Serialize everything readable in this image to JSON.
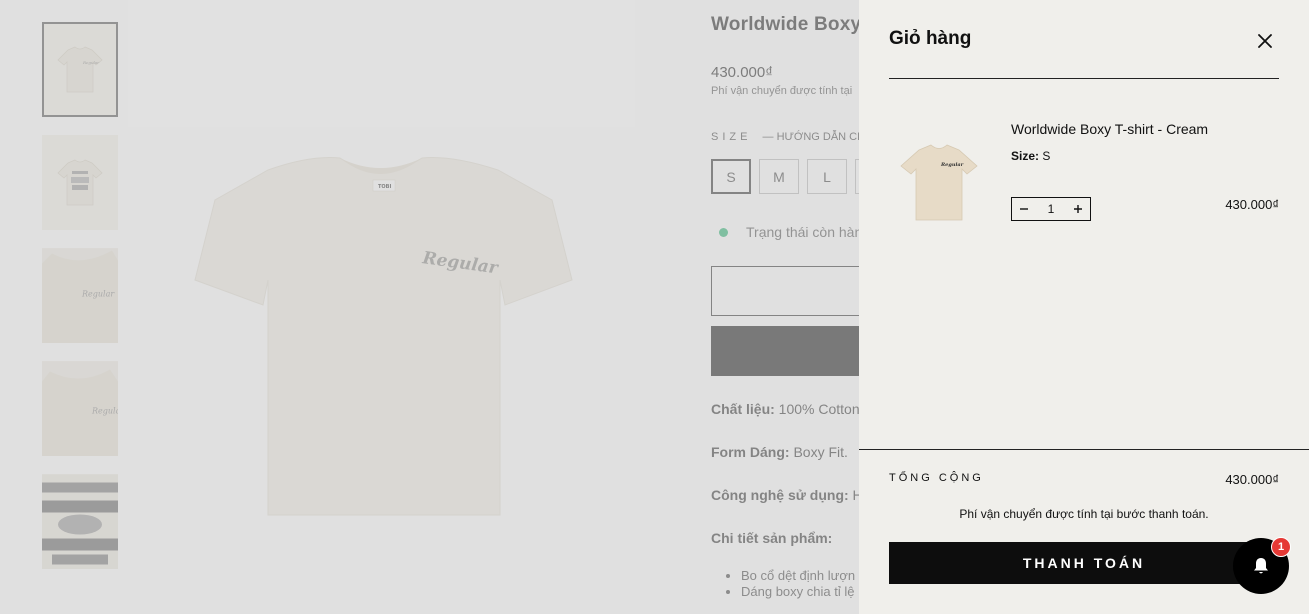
{
  "product": {
    "title": "Worldwide Boxy",
    "price": "430.000₫",
    "shipping_note": "Phí vận chuyển được tính tại",
    "size_label": "SIZE",
    "size_guide": "— HƯỚNG DẪN CHỌ",
    "sizes": [
      "S",
      "M",
      "L",
      ""
    ],
    "selected_size": "S",
    "stock_status": "Trạng thái còn hàn",
    "material_label": "Chất liệu:",
    "material_value": " 100% Cotton",
    "form_label": "Form Dáng:",
    "form_value": " Boxy Fit.",
    "tech_label": "Công nghệ sử dụng:",
    "tech_value": " Hì",
    "details_label": "Chi tiết sản phẩm:",
    "bullets": [
      "Bo cổ dệt định lượn",
      "Dáng boxy chia tỉ lệ"
    ],
    "shirt_print": "Regular",
    "neck_label": "TOBI"
  },
  "cart": {
    "title": "Giỏ hàng",
    "close_icon": "close-icon",
    "items": [
      {
        "name": "Worldwide Boxy T-shirt - Cream",
        "variant_label": "Size:",
        "variant_value": " S",
        "quantity": "1",
        "price": "430.000₫"
      }
    ],
    "total_label": "TỔNG CỘNG",
    "total_value": "430.000₫",
    "shipping_note": "Phí vận chuyển được tính tại bước thanh toán.",
    "checkout_label": "THANH TOÁN"
  },
  "notification": {
    "icon": "bell-icon",
    "count": "1"
  },
  "colors": {
    "drawer_bg": "#f0efeb",
    "shirt_cream": "#f1ede4",
    "checkout_bg": "#0d0d0d",
    "badge_red": "#e53935",
    "stock_green": "#2bb673"
  }
}
